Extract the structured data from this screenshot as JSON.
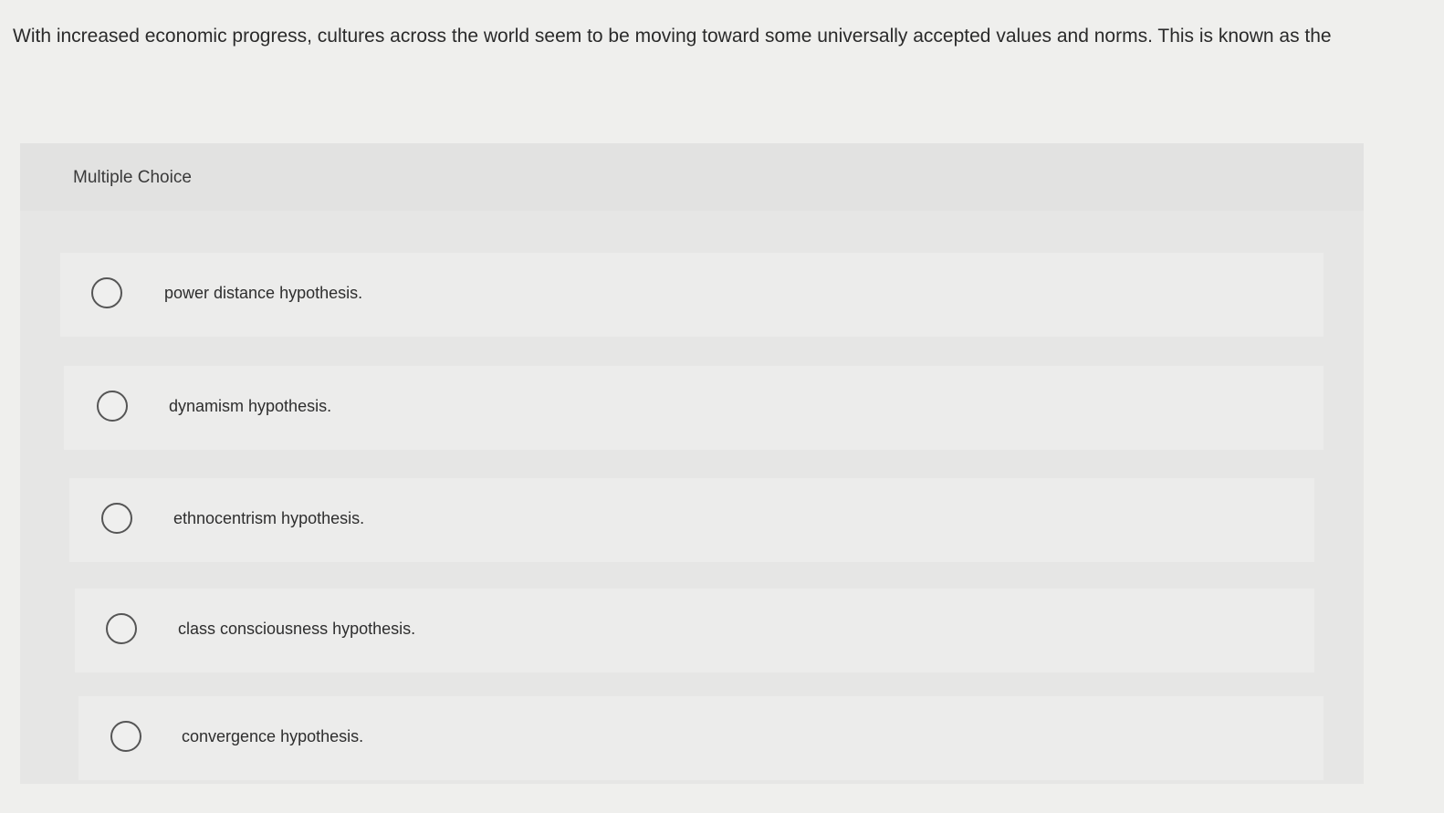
{
  "question": {
    "text": "With increased economic progress, cultures across the world seem to be moving toward some universally accepted values and norms. This is known as the"
  },
  "panel": {
    "title": "Multiple Choice"
  },
  "options": [
    {
      "label": "power distance hypothesis."
    },
    {
      "label": "dynamism hypothesis."
    },
    {
      "label": "ethnocentrism hypothesis."
    },
    {
      "label": "class consciousness hypothesis."
    },
    {
      "label": "convergence hypothesis."
    }
  ]
}
